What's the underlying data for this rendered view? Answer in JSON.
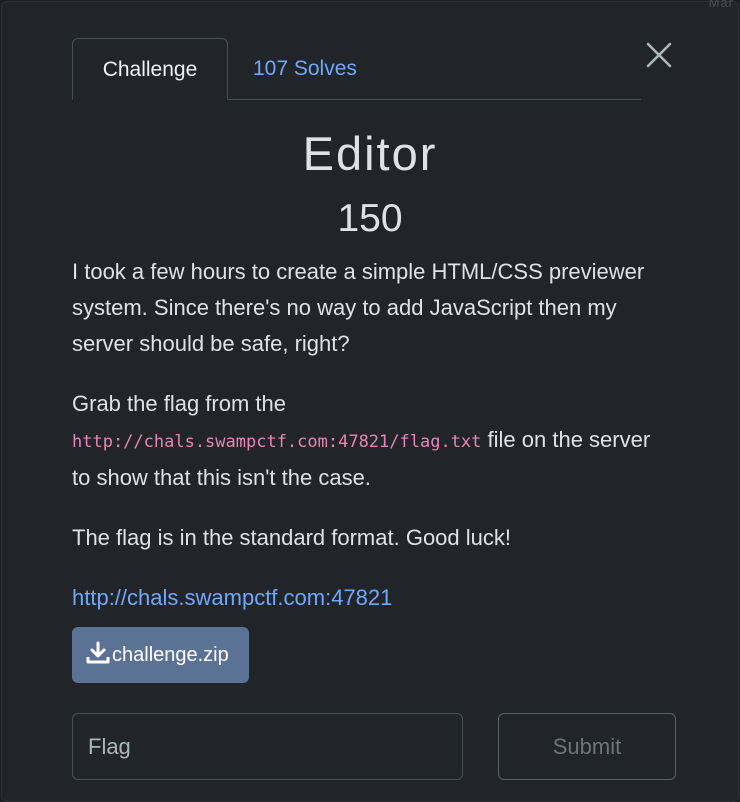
{
  "background_label": "Mar",
  "tabs": [
    {
      "label": "Challenge",
      "active": true
    },
    {
      "label": "107 Solves",
      "active": false
    }
  ],
  "challenge": {
    "name": "Editor",
    "points": "150",
    "description": {
      "p1": "I took a few hours to create a simple HTML/CSS previewer system. Since there's no way to add JavaScript then my server should be safe, right?",
      "p2_before": "Grab the flag from the",
      "p2_code": "http://chals.swampctf.com:47821/flag.txt",
      "p2_after": "file on the server to show that this isn't the case.",
      "p3": "The flag is in the standard format. Good luck!",
      "link": "http://chals.swampctf.com:47821"
    },
    "file_label": "challenge.zip"
  },
  "form": {
    "flag_placeholder": "Flag",
    "submit_label": "Submit"
  },
  "icons": {
    "close": "close-icon",
    "download": "download-icon"
  },
  "colors": {
    "background": "#212529",
    "link": "#6ea8fe",
    "code": "#e685b5",
    "file_button": "#5c7294"
  }
}
